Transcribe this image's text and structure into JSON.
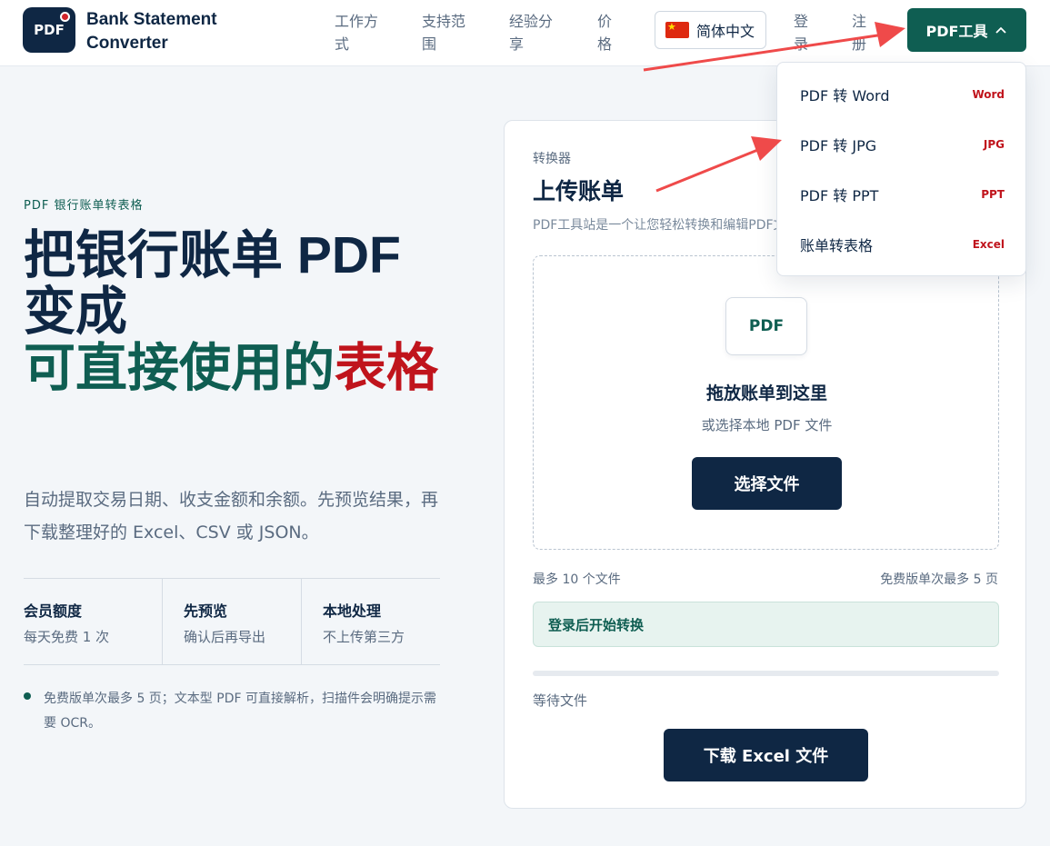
{
  "header": {
    "logo_text": "PDF",
    "brand_line1": "Bank Statement",
    "brand_line2": "Converter",
    "nav": [
      {
        "line1": "工作方",
        "line2": "式"
      },
      {
        "line1": "支持范",
        "line2": "围"
      },
      {
        "line1": "经验分",
        "line2": "享"
      },
      {
        "line1": "价",
        "line2": "格"
      }
    ],
    "language": "简体中文",
    "login": {
      "line1": "登",
      "line2": "录"
    },
    "register": {
      "line1": "注",
      "line2": "册"
    },
    "pdf_tools": "PDF工具",
    "chevron": "^"
  },
  "dropdown": {
    "items": [
      {
        "label": "PDF 转 Word",
        "tag": "Word"
      },
      {
        "label": "PDF 转 JPG",
        "tag": "JPG"
      },
      {
        "label": "PDF 转 PPT",
        "tag": "PPT"
      },
      {
        "label": "账单转表格",
        "tag": "Excel"
      }
    ]
  },
  "hero": {
    "eyebrow": "PDF 银行账单转表格",
    "title_line1": "把银行账单 PDF",
    "title_line2": "变成",
    "title_green": "可直接使用的",
    "title_red": "表格",
    "lede": "自动提取交易日期、收支金额和余额。先预览结果，再下载整理好的 Excel、CSV 或 JSON。",
    "stats": [
      {
        "title": "会员额度",
        "sub": "每天免费 1 次"
      },
      {
        "title": "先预览",
        "sub": "确认后再导出"
      },
      {
        "title": "本地处理",
        "sub": "不上传第三方"
      }
    ],
    "note": "免费版单次最多 5 页；文本型 PDF 可直接解析，扫描件会明确提示需要 OCR。"
  },
  "card": {
    "eyebrow": "转换器",
    "title": "上传账单",
    "desc": "PDF工具站是一个让您轻松转换和编辑PDF文件的工具",
    "badge": "PDF",
    "drop_title": "拖放账单到这里",
    "drop_sub": "或选择本地 PDF 文件",
    "choose": "选择文件",
    "max_files": "最多 10 个文件",
    "max_pages": "免费版单次最多 5 页",
    "login_prompt": "登录后开始转换",
    "progress": 0,
    "status": "等待文件",
    "download": "下载 Excel 文件"
  },
  "colors": {
    "navy": "#0f2744",
    "green": "#0f5e52",
    "red": "#c0141c",
    "annotation_arrow": "#ef4a4a"
  },
  "icons": {
    "flag": "china-flag-icon",
    "chevron": "chevron-up-icon",
    "dot": "bullet-dot-icon"
  }
}
